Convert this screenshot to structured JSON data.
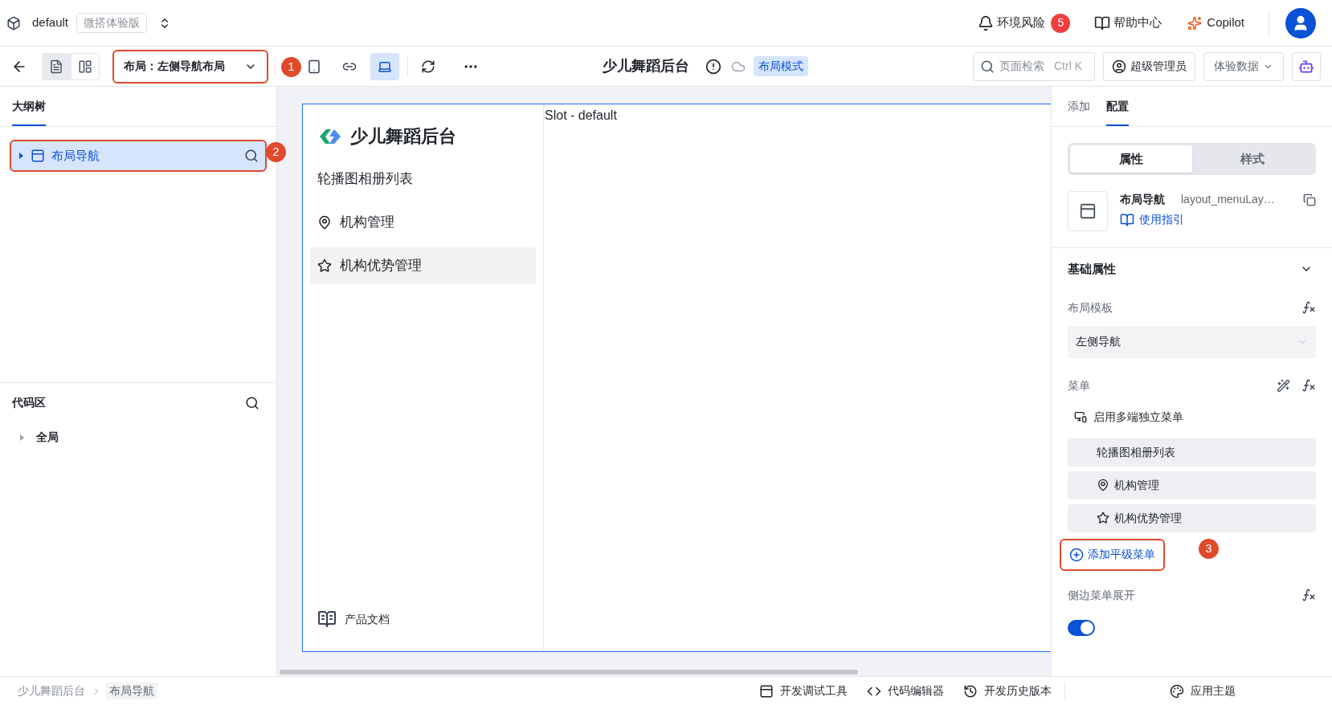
{
  "header": {
    "app_name": "default",
    "edition": "微搭体验版",
    "env_risk": {
      "label": "环境风险",
      "count": "5"
    },
    "help": "帮助中心",
    "copilot": "Copilot"
  },
  "toolbar": {
    "view_toggles": [
      {
        "selected": true
      },
      {
        "selected": false
      }
    ],
    "layout_select": "布局：左侧导航布局",
    "devices": [
      {
        "selected": false
      },
      {
        "selected": false
      },
      {
        "selected": true
      }
    ],
    "page_title": "少儿舞蹈后台",
    "mode_badge": "布局模式",
    "search": {
      "placeholder": "页面检索",
      "shortcut": "Ctrl K"
    },
    "role": "超级管理员",
    "data_select": "体验数据"
  },
  "outline": {
    "title": "大纲树",
    "nodes": [
      {
        "label": "布局导航",
        "selected": true,
        "expanded": false
      }
    ]
  },
  "code_area": {
    "title": "代码区",
    "nodes": [
      {
        "label": "全局",
        "expanded": false
      }
    ]
  },
  "canvas": {
    "brand": "少儿舞蹈后台",
    "menu": [
      {
        "label": "轮播图相册列表",
        "selected": false
      },
      {
        "label": "机构管理",
        "selected": false
      },
      {
        "label": "机构优势管理",
        "selected": true
      }
    ],
    "footer_link": "产品文档",
    "slot": "Slot - default"
  },
  "right_panel": {
    "tabs": [
      {
        "label": "添加",
        "selected": false
      },
      {
        "label": "配置",
        "selected": true
      }
    ],
    "segments": [
      {
        "label": "属性",
        "selected": true
      },
      {
        "label": "样式",
        "selected": false
      }
    ],
    "component": {
      "name": "布局导航",
      "id": "layout_menuLay…",
      "guide": "使用指引"
    },
    "section": {
      "title": "基础属性",
      "expanded": true
    },
    "layout_template": {
      "label": "布局模板",
      "value": "左侧导航"
    },
    "menu": {
      "label": "菜单",
      "multi_end": "启用多端独立菜单",
      "items": [
        "轮播图相册列表",
        "机构管理",
        "机构优势管理"
      ],
      "add": "添加平级菜单"
    },
    "side_expand": {
      "label": "侧边菜单展开",
      "on": true
    }
  },
  "annotations": [
    "1",
    "2",
    "3"
  ],
  "breadcrumb": [
    "少儿舞蹈后台",
    "布局导航"
  ],
  "footer_tools": [
    "开发调试工具",
    "代码编辑器",
    "开发历史版本",
    "应用主题"
  ]
}
